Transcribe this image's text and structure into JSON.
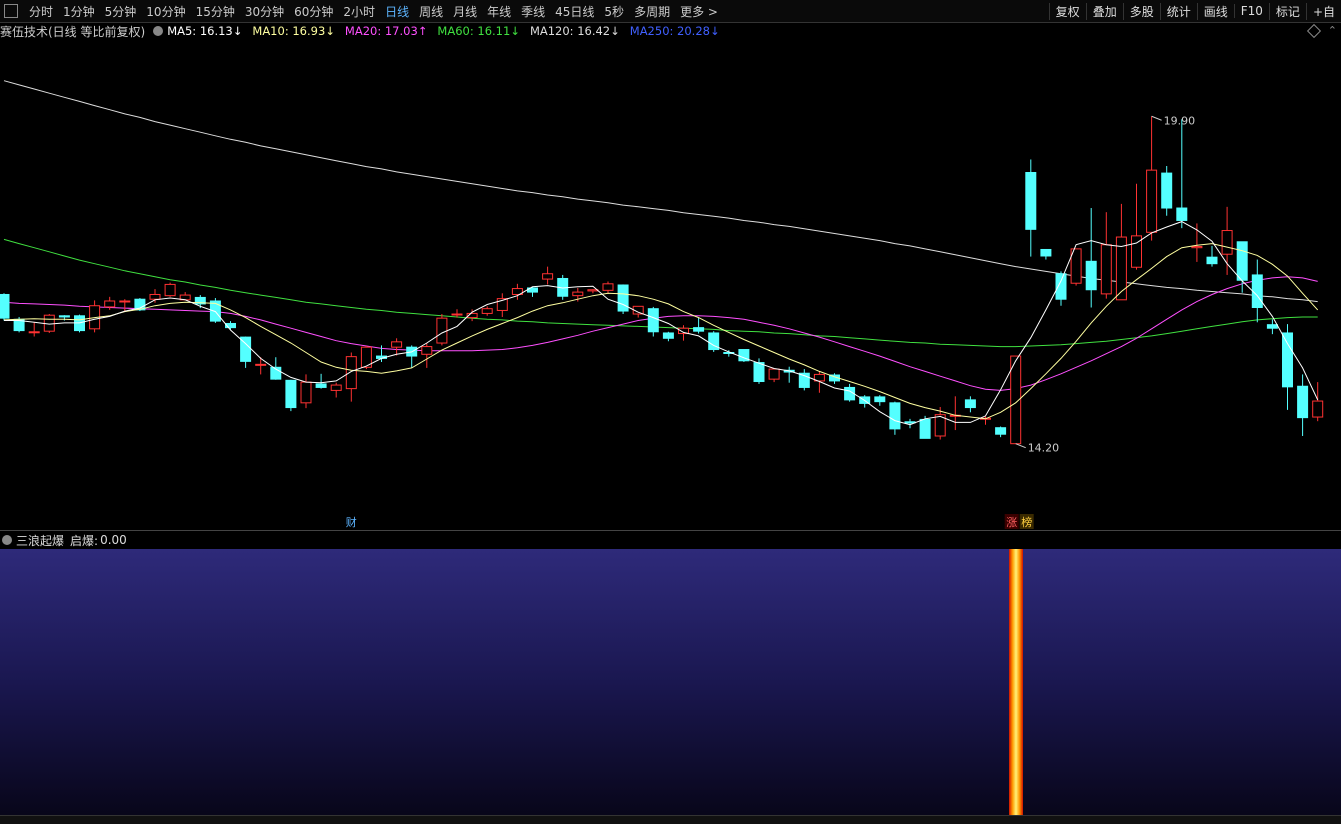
{
  "toolbar": {
    "periods": [
      "分时",
      "1分钟",
      "5分钟",
      "10分钟",
      "15分钟",
      "30分钟",
      "60分钟",
      "2小时",
      "日线",
      "周线",
      "月线",
      "年线",
      "季线",
      "45日线",
      "5秒",
      "多周期",
      "更多 >"
    ],
    "active_period": "日线",
    "right_tools": [
      "复权",
      "叠加",
      "多股",
      "统计",
      "画线",
      "F10",
      "标记",
      "+自"
    ]
  },
  "main_header": {
    "title": "赛伍技术(日线 等比前复权)",
    "ma": [
      {
        "label": "MA5: 16.13↓",
        "color": "#ffffff"
      },
      {
        "label": "MA10: 16.93↓",
        "color": "#ffffa0"
      },
      {
        "label": "MA20: 17.03↑",
        "color": "#ff50ff"
      },
      {
        "label": "MA60: 16.11↓",
        "color": "#40e040"
      },
      {
        "label": "MA120: 16.42↓",
        "color": "#dddddd"
      },
      {
        "label": "MA250: 20.28↓",
        "color": "#4060ff"
      }
    ]
  },
  "sub_header": {
    "title": "三浪起爆",
    "indicator_label": "启爆:",
    "indicator_value": "0.00"
  },
  "chart_data": {
    "type": "candlestick",
    "price_range": [
      13.3,
      20.9
    ],
    "colors": {
      "up": "#ff3232",
      "down": "#54ffff",
      "ma5": "#ffffff",
      "ma10": "#ffffa0",
      "ma20": "#ff50ff",
      "ma60": "#40e040",
      "ma120": "#dddddd"
    },
    "candles": [
      [
        16.94,
        16.54,
        16.96,
        16.5
      ],
      [
        16.52,
        16.33,
        16.56,
        16.3
      ],
      [
        16.31,
        16.31,
        16.47,
        16.23
      ],
      [
        16.32,
        16.59,
        16.61,
        16.29
      ],
      [
        16.58,
        16.56,
        16.59,
        16.5
      ],
      [
        16.58,
        16.33,
        16.6,
        16.3
      ],
      [
        16.36,
        16.75,
        16.84,
        16.3
      ],
      [
        16.73,
        16.83,
        16.9,
        16.68
      ],
      [
        16.83,
        16.83,
        16.86,
        16.66
      ],
      [
        16.86,
        16.68,
        16.88,
        16.66
      ],
      [
        16.86,
        16.94,
        17.03,
        16.8
      ],
      [
        16.92,
        17.11,
        17.14,
        16.9
      ],
      [
        16.85,
        16.93,
        16.98,
        16.84
      ],
      [
        16.89,
        16.78,
        16.93,
        16.71
      ],
      [
        16.83,
        16.49,
        16.88,
        16.46
      ],
      [
        16.45,
        16.38,
        16.49,
        16.35
      ],
      [
        16.22,
        15.81,
        16.23,
        15.7
      ],
      [
        15.76,
        15.76,
        15.88,
        15.59
      ],
      [
        15.71,
        15.51,
        15.88,
        15.5
      ],
      [
        15.49,
        15.03,
        15.5,
        14.97
      ],
      [
        15.11,
        15.46,
        15.59,
        15.02
      ],
      [
        15.43,
        15.37,
        15.6,
        15.35
      ],
      [
        15.32,
        15.41,
        15.45,
        15.2
      ],
      [
        15.35,
        15.89,
        15.96,
        15.13
      ],
      [
        15.71,
        16.05,
        16.07,
        15.68
      ],
      [
        15.9,
        15.86,
        16.08,
        15.8
      ],
      [
        16.05,
        16.14,
        16.2,
        15.91
      ],
      [
        16.05,
        15.9,
        16.08,
        15.7
      ],
      [
        15.93,
        16.06,
        16.12,
        15.7
      ],
      [
        16.12,
        16.54,
        16.61,
        16.08
      ],
      [
        16.6,
        16.61,
        16.69,
        16.55
      ],
      [
        16.55,
        16.62,
        16.69,
        16.49
      ],
      [
        16.62,
        16.7,
        16.74,
        16.58
      ],
      [
        16.67,
        16.87,
        16.96,
        16.56
      ],
      [
        16.94,
        17.04,
        17.12,
        16.85
      ],
      [
        17.05,
        16.98,
        17.07,
        16.9
      ],
      [
        17.2,
        17.29,
        17.41,
        17.11
      ],
      [
        17.21,
        16.91,
        17.27,
        16.85
      ],
      [
        16.92,
        16.98,
        17.05,
        16.82
      ],
      [
        17.0,
        17.02,
        17.03,
        16.96
      ],
      [
        17.01,
        17.12,
        17.16,
        16.95
      ],
      [
        17.1,
        16.66,
        17.11,
        16.61
      ],
      [
        16.61,
        16.74,
        16.73,
        16.55
      ],
      [
        16.7,
        16.31,
        16.73,
        16.23
      ],
      [
        16.29,
        16.2,
        16.31,
        16.15
      ],
      [
        16.28,
        16.37,
        16.42,
        16.16
      ],
      [
        16.38,
        16.32,
        16.55,
        16.28
      ],
      [
        16.29,
        16.01,
        16.32,
        15.97
      ],
      [
        15.96,
        15.95,
        16.0,
        15.89
      ],
      [
        16.01,
        15.82,
        16.01,
        15.8
      ],
      [
        15.79,
        15.47,
        15.86,
        15.43
      ],
      [
        15.51,
        15.68,
        15.68,
        15.46
      ],
      [
        15.66,
        15.63,
        15.72,
        15.45
      ],
      [
        15.61,
        15.37,
        15.68,
        15.32
      ],
      [
        15.48,
        15.59,
        15.64,
        15.28
      ],
      [
        15.58,
        15.48,
        15.61,
        15.43
      ],
      [
        15.37,
        15.16,
        15.43,
        15.13
      ],
      [
        15.21,
        15.1,
        15.24,
        15.03
      ],
      [
        15.21,
        15.13,
        15.24,
        15.06
      ],
      [
        15.11,
        14.67,
        15.13,
        14.57
      ],
      [
        14.79,
        14.77,
        14.84,
        14.68
      ],
      [
        14.83,
        14.51,
        14.89,
        14.51
      ],
      [
        14.55,
        14.91,
        15.04,
        14.49
      ],
      [
        14.9,
        14.9,
        15.22,
        14.65
      ],
      [
        15.16,
        15.03,
        15.22,
        14.95
      ],
      [
        14.85,
        14.85,
        14.88,
        14.74
      ],
      [
        14.69,
        14.58,
        14.71,
        14.53
      ],
      [
        14.42,
        15.9,
        15.9,
        14.42
      ],
      [
        19.0,
        18.04,
        19.22,
        17.58
      ],
      [
        17.7,
        17.59,
        17.67,
        17.53
      ],
      [
        17.29,
        16.86,
        17.33,
        16.75
      ],
      [
        17.13,
        17.71,
        17.66,
        17.09
      ],
      [
        17.5,
        17.02,
        18.4,
        16.72
      ],
      [
        16.95,
        17.78,
        18.33,
        16.87
      ],
      [
        16.85,
        17.91,
        18.47,
        16.87
      ],
      [
        17.4,
        17.93,
        18.81,
        17.36
      ],
      [
        17.99,
        19.04,
        19.95,
        17.85
      ],
      [
        18.99,
        18.4,
        19.11,
        18.27
      ],
      [
        18.4,
        18.19,
        19.9,
        18.06
      ],
      [
        17.73,
        17.75,
        18.14,
        17.49
      ],
      [
        17.57,
        17.46,
        17.76,
        17.41
      ],
      [
        17.62,
        18.02,
        18.42,
        17.27
      ],
      [
        17.83,
        17.18,
        17.83,
        16.97
      ],
      [
        17.27,
        16.72,
        17.53,
        16.47
      ],
      [
        16.43,
        16.37,
        16.52,
        16.27
      ],
      [
        16.29,
        15.38,
        16.44,
        14.99
      ],
      [
        15.39,
        14.86,
        15.59,
        14.55
      ],
      [
        14.87,
        15.14,
        15.46,
        14.8
      ]
    ],
    "ma5": [
      16.5,
      16.5,
      16.47,
      16.44,
      16.46,
      16.46,
      16.52,
      16.57,
      16.66,
      16.71,
      16.85,
      16.88,
      16.85,
      16.74,
      16.65,
      16.34,
      16.11,
      15.86,
      15.68,
      15.54,
      15.46,
      15.45,
      15.48,
      15.64,
      15.73,
      15.86,
      15.93,
      15.97,
      16.12,
      16.29,
      16.4,
      16.64,
      16.77,
      16.84,
      16.92,
      17.07,
      17.09,
      17.05,
      17.07,
      17.08,
      16.86,
      16.77,
      16.64,
      16.55,
      16.45,
      16.3,
      16.24,
      16.08,
      15.97,
      15.87,
      15.78,
      15.69,
      15.65,
      15.57,
      15.47,
      15.36,
      15.31,
      15.15,
      14.96,
      14.81,
      14.74,
      14.84,
      14.88,
      14.78,
      14.78,
      14.89,
      15.33,
      15.82,
      16.21,
      16.68,
      17.17,
      17.78,
      17.85,
      17.78,
      17.75,
      17.81,
      17.98,
      18.08,
      18.17,
      18.03,
      17.84,
      17.46,
      17.17,
      16.92,
      16.57,
      16.11,
      15.7,
      15.16
    ],
    "ma10": [
      16.51,
      16.52,
      16.53,
      16.52,
      16.52,
      16.51,
      16.55,
      16.58,
      16.65,
      16.69,
      16.75,
      16.79,
      16.81,
      16.8,
      16.79,
      16.68,
      16.55,
      16.4,
      16.26,
      16.12,
      15.96,
      15.8,
      15.71,
      15.66,
      15.64,
      15.61,
      15.65,
      15.7,
      15.85,
      16.0,
      16.12,
      16.24,
      16.35,
      16.45,
      16.55,
      16.66,
      16.75,
      16.8,
      16.86,
      16.92,
      16.96,
      16.95,
      16.92,
      16.86,
      16.78,
      16.65,
      16.55,
      16.42,
      16.3,
      16.18,
      16.07,
      15.96,
      15.85,
      15.75,
      15.64,
      15.55,
      15.47,
      15.39,
      15.3,
      15.2,
      15.1,
      15.03,
      14.97,
      14.9,
      14.87,
      14.84,
      14.95,
      15.11,
      15.35,
      15.6,
      15.86,
      16.15,
      16.46,
      16.74,
      16.99,
      17.19,
      17.38,
      17.58,
      17.73,
      17.77,
      17.8,
      17.74,
      17.68,
      17.6,
      17.45,
      17.25,
      16.96,
      16.68
    ],
    "ma20": [
      16.81,
      16.79,
      16.78,
      16.77,
      16.76,
      16.74,
      16.73,
      16.72,
      16.71,
      16.7,
      16.69,
      16.68,
      16.67,
      16.66,
      16.65,
      16.62,
      16.57,
      16.51,
      16.44,
      16.37,
      16.3,
      16.23,
      16.16,
      16.11,
      16.07,
      16.03,
      16.01,
      16.0,
      15.99,
      15.99,
      15.99,
      15.99,
      16.0,
      16.01,
      16.04,
      16.08,
      16.13,
      16.19,
      16.25,
      16.32,
      16.38,
      16.44,
      16.5,
      16.54,
      16.57,
      16.58,
      16.58,
      16.57,
      16.55,
      16.52,
      16.47,
      16.42,
      16.36,
      16.29,
      16.22,
      16.14,
      16.06,
      15.98,
      15.9,
      15.81,
      15.72,
      15.64,
      15.56,
      15.48,
      15.4,
      15.34,
      15.32,
      15.35,
      15.41,
      15.5,
      15.6,
      15.71,
      15.82,
      15.94,
      16.06,
      16.2,
      16.36,
      16.52,
      16.68,
      16.82,
      16.94,
      17.04,
      17.12,
      17.18,
      17.22,
      17.24,
      17.22,
      17.16
    ],
    "ma60": [
      17.87,
      17.8,
      17.73,
      17.66,
      17.59,
      17.52,
      17.46,
      17.4,
      17.34,
      17.29,
      17.24,
      17.19,
      17.15,
      17.1,
      17.06,
      17.01,
      16.97,
      16.93,
      16.89,
      16.85,
      16.81,
      16.78,
      16.75,
      16.72,
      16.69,
      16.67,
      16.64,
      16.62,
      16.6,
      16.58,
      16.56,
      16.54,
      16.52,
      16.51,
      16.49,
      16.48,
      16.46,
      16.45,
      16.44,
      16.43,
      16.42,
      16.41,
      16.4,
      16.39,
      16.38,
      16.37,
      16.36,
      16.35,
      16.33,
      16.32,
      16.31,
      16.29,
      16.28,
      16.26,
      16.24,
      16.23,
      16.21,
      16.19,
      16.17,
      16.15,
      16.13,
      16.12,
      16.1,
      16.09,
      16.08,
      16.07,
      16.06,
      16.06,
      16.07,
      16.08,
      16.09,
      16.11,
      16.13,
      16.15,
      16.18,
      16.21,
      16.24,
      16.28,
      16.32,
      16.36,
      16.4,
      16.44,
      16.48,
      16.51,
      16.53,
      16.55,
      16.56,
      16.56
    ],
    "ma120": [
      20.55,
      20.48,
      20.41,
      20.34,
      20.27,
      20.2,
      20.13,
      20.06,
      19.99,
      19.93,
      19.86,
      19.8,
      19.74,
      19.68,
      19.62,
      19.56,
      19.51,
      19.45,
      19.4,
      19.35,
      19.3,
      19.25,
      19.2,
      19.15,
      19.1,
      19.06,
      19.01,
      18.97,
      18.93,
      18.89,
      18.85,
      18.81,
      18.77,
      18.73,
      18.69,
      18.66,
      18.62,
      18.59,
      18.55,
      18.52,
      18.49,
      18.45,
      18.42,
      18.39,
      18.36,
      18.32,
      18.29,
      18.26,
      18.23,
      18.19,
      18.16,
      18.12,
      18.09,
      18.05,
      18.01,
      17.97,
      17.93,
      17.89,
      17.85,
      17.8,
      17.76,
      17.71,
      17.66,
      17.61,
      17.56,
      17.51,
      17.46,
      17.41,
      17.37,
      17.33,
      17.29,
      17.25,
      17.21,
      17.18,
      17.15,
      17.12,
      17.09,
      17.06,
      17.04,
      17.01,
      16.99,
      16.97,
      16.95,
      16.92,
      16.9,
      16.87,
      16.85,
      16.82
    ],
    "annotations": {
      "high_label": "19.90",
      "low_label": "14.20",
      "event_cai": "财",
      "event_zhang": "涨",
      "event_bang": "榜"
    },
    "signal_index": 67
  }
}
